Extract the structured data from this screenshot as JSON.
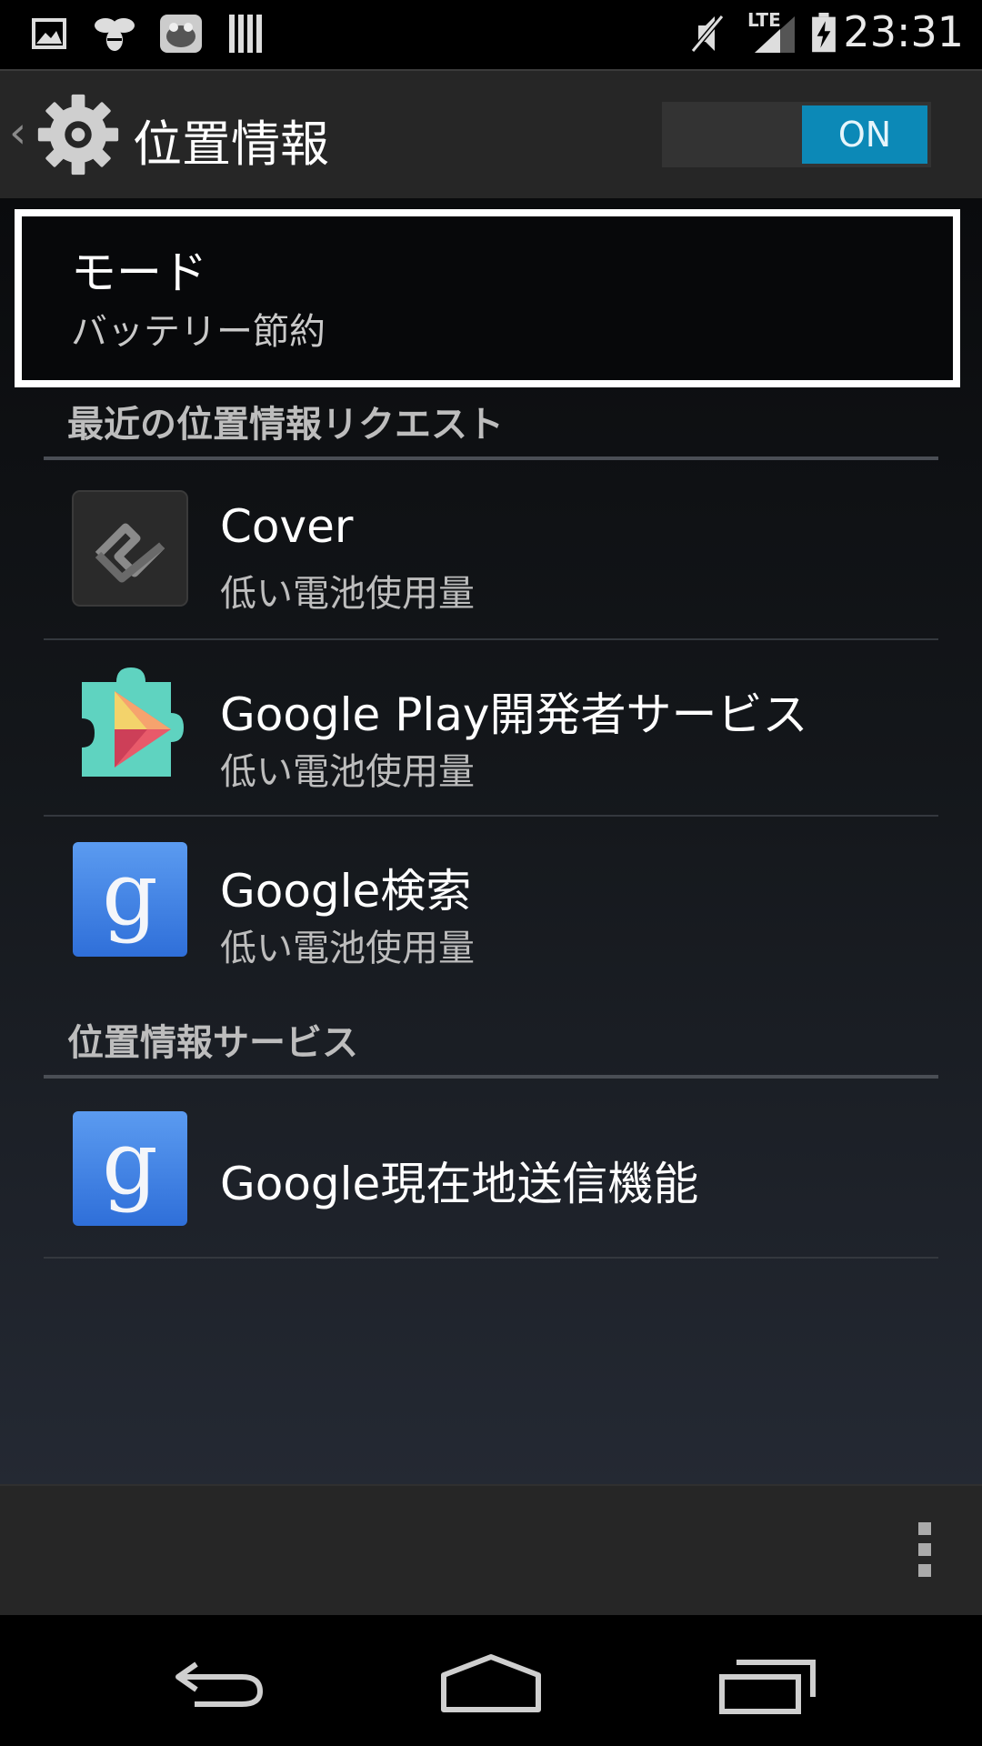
{
  "status_bar": {
    "time": "23:31",
    "network": "LTE",
    "icons": [
      "picture-icon",
      "bee-icon",
      "frog-icon",
      "barcode-icon",
      "mute-icon",
      "signal-icon",
      "battery-charging-icon"
    ]
  },
  "action_bar": {
    "title": "位置情報",
    "toggle_label": "ON",
    "accent": "#0c89b7"
  },
  "mode": {
    "title": "モード",
    "value": "バッテリー節約"
  },
  "recent_requests": {
    "header": "最近の位置情報リクエスト",
    "apps": [
      {
        "name": "Cover",
        "usage": "低い電池使用量",
        "icon": "cover-app-icon"
      },
      {
        "name": "Google Play開発者サービス",
        "usage": "低い電池使用量",
        "icon": "google-play-services-icon"
      },
      {
        "name": "Google検索",
        "usage": "低い電池使用量",
        "icon": "google-search-icon"
      }
    ]
  },
  "location_services": {
    "header": "位置情報サービス",
    "items": [
      {
        "name": "Google現在地送信機能",
        "icon": "google-location-reporting-icon"
      }
    ]
  },
  "bottom_bar": {
    "icon": "overflow-menu-icon"
  },
  "nav_bar": {
    "icons": [
      "back-icon",
      "home-icon",
      "recents-icon"
    ]
  }
}
